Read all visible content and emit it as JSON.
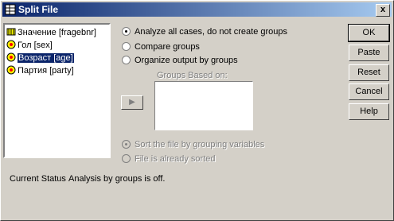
{
  "window": {
    "title": "Split File",
    "close_label": "x"
  },
  "variables": [
    {
      "label": "Значение [fragebnr]",
      "icon": "scale-var-icon",
      "selected": false
    },
    {
      "label": "Гол [sex]",
      "icon": "nominal-var-icon",
      "selected": false
    },
    {
      "label": "Возраст [age]",
      "icon": "nominal-var-icon",
      "selected": true
    },
    {
      "label": "Партия [party]",
      "icon": "nominal-var-icon",
      "selected": false
    }
  ],
  "options": {
    "analyze_all": "Analyze all cases, do not create groups",
    "compare": "Compare groups",
    "organize": "Organize output by groups",
    "selected": "analyze_all"
  },
  "groups_label": "Groups Based on:",
  "move_button": "▶",
  "sort_options": {
    "sort": "Sort the file by grouping variables",
    "already_sorted": "File is already sorted"
  },
  "buttons": {
    "ok": "OK",
    "paste": "Paste",
    "reset": "Reset",
    "cancel": "Cancel",
    "help": "Help"
  },
  "status": {
    "label": "Current Status",
    "value": "Analysis by groups is off."
  },
  "colors": {
    "title_start": "#0a246a",
    "title_end": "#a6caf0",
    "face": "#d4d0c8"
  }
}
